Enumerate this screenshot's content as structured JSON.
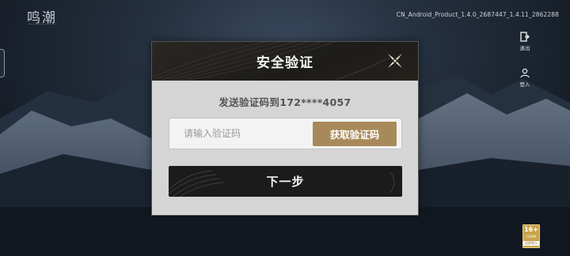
{
  "app": {
    "logo_text": "鸣潮",
    "version": "CN_Android_Product_1.4.0_2687447_1.4.11_2862288"
  },
  "side_menu": {
    "exit_label": "退出",
    "login_label": "登入"
  },
  "age_rating": {
    "number": "16+",
    "caption": "CADPA",
    "badge": "适龄提示"
  },
  "dialog": {
    "title": "安全验证",
    "sent_to_text": "发送验证码到172****4057",
    "code_placeholder": "请输入验证码",
    "code_value": "",
    "get_code_label": "获取验证码",
    "next_label": "下一步"
  },
  "colors": {
    "header_bg": "#1d1c19",
    "dialog_bg": "#d5d5d5",
    "accent_gold": "#a88a5a",
    "next_button_bg": "#1b1b1b"
  }
}
